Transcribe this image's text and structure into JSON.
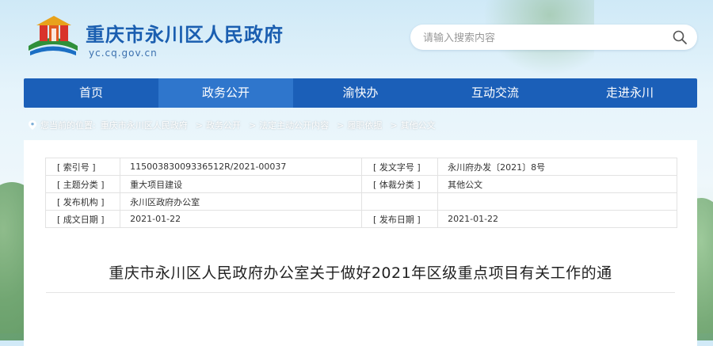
{
  "header": {
    "site_title": "重庆市永川区人民政府",
    "site_domain": "yc.cq.gov.cn",
    "search_placeholder": "请输入搜索内容"
  },
  "nav": {
    "items": [
      {
        "label": "首页",
        "active": false
      },
      {
        "label": "政务公开",
        "active": true
      },
      {
        "label": "渝快办",
        "active": false
      },
      {
        "label": "互动交流",
        "active": false
      },
      {
        "label": "走进永川",
        "active": false
      }
    ]
  },
  "breadcrumb": {
    "prefix": "您当前的位置:",
    "items": [
      "重庆市永川区人民政府",
      "政务公开",
      "法定主动公开内容",
      "履职依据",
      "其他公文"
    ],
    "separator": ">"
  },
  "meta": {
    "rows": [
      [
        {
          "key": "[ 索引号 ]",
          "value": "11500383009336512R/2021-00037"
        },
        {
          "key": "[ 发文字号 ]",
          "value": "永川府办发〔2021〕8号"
        }
      ],
      [
        {
          "key": "[ 主题分类 ]",
          "value": "重大项目建设"
        },
        {
          "key": "[ 体裁分类 ]",
          "value": "其他公文"
        }
      ],
      [
        {
          "key": "[ 发布机构 ]",
          "value": "永川区政府办公室"
        },
        {
          "key": "",
          "value": ""
        }
      ],
      [
        {
          "key": "[ 成文日期 ]",
          "value": "2021-01-22"
        },
        {
          "key": "[ 发布日期 ]",
          "value": "2021-01-22"
        }
      ]
    ]
  },
  "document": {
    "title": "重庆市永川区人民政府办公室关于做好2021年区级重点项目有关工作的通"
  },
  "colors": {
    "brand_blue": "#1b5fb8",
    "nav_active": "#2f76cc",
    "title_blue": "#1a5eb0"
  }
}
